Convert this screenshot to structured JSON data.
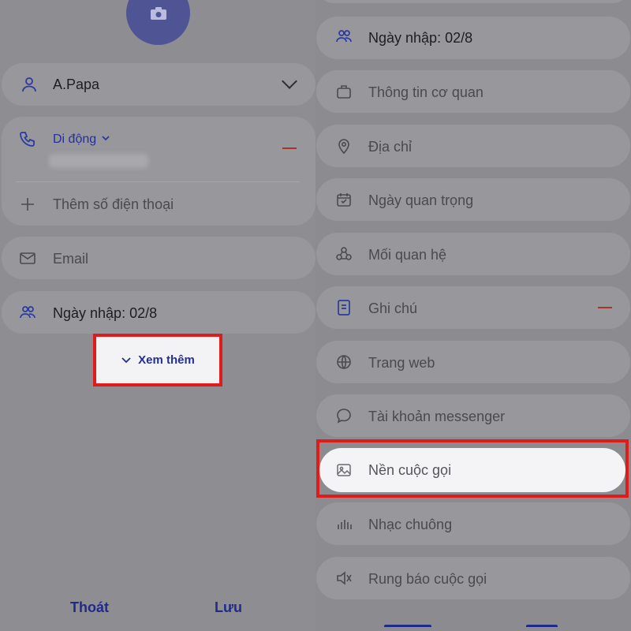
{
  "left": {
    "name_value": "A.Papa",
    "phone_type": "Di động",
    "add_phone_placeholder": "Thêm số điện thoại",
    "email_placeholder": "Email",
    "import_date": "Ngày nhập: 02/8",
    "see_more_label": "Xem thêm",
    "cancel_label": "Thoát",
    "save_label": "Lưu"
  },
  "right": {
    "items": [
      {
        "label": "Ngày nhập: 02/8",
        "icon": "people-icon"
      },
      {
        "label": "Thông tin cơ quan",
        "icon": "briefcase-icon"
      },
      {
        "label": "Địa chỉ",
        "icon": "location-icon"
      },
      {
        "label": "Ngày quan trọng",
        "icon": "calendar-icon"
      },
      {
        "label": "Mối quan hệ",
        "icon": "relationship-icon"
      },
      {
        "label": "Ghi chú",
        "icon": "note-icon"
      },
      {
        "label": "Trang web",
        "icon": "globe-icon"
      },
      {
        "label": "Tài khoản messenger",
        "icon": "chat-icon"
      },
      {
        "label": "Nền cuộc gọi",
        "icon": "image-icon"
      },
      {
        "label": "Nhạc chuông",
        "icon": "ringtone-icon"
      },
      {
        "label": "Rung báo cuộc gọi",
        "icon": "vibrate-icon"
      }
    ]
  },
  "colors": {
    "accent_blue": "#22309a",
    "highlight_red": "#e01b1b",
    "remove_red": "#a9322f"
  }
}
